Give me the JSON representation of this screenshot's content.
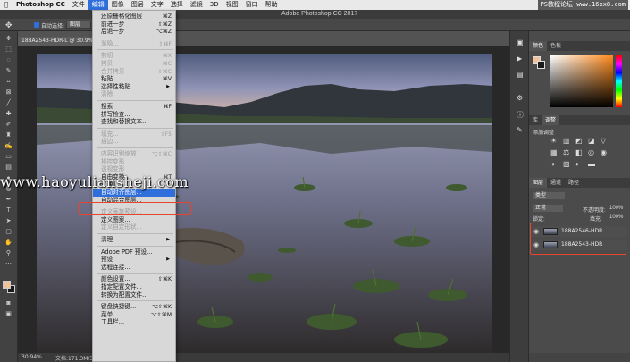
{
  "menubar": {
    "app_name": "Photoshop CC",
    "items": [
      "文件",
      "编辑",
      "图像",
      "图层",
      "文字",
      "选择",
      "滤镜",
      "3D",
      "视图",
      "窗口",
      "帮助"
    ],
    "active_item": "编辑"
  },
  "watermark_top": "PS教程论坛 www.16xx8.com",
  "window_title": "Adobe Photoshop CC 2017",
  "options_bar": {
    "auto_select_label": "自动选择:",
    "auto_select_value": "图层"
  },
  "document_tab": "188A2543-HDR-L @ 30.9% (RGB/8)",
  "status_bar": {
    "zoom": "30.94%",
    "doc_info": "文档:171.3M/343.4M"
  },
  "edit_menu": [
    {
      "label": "还原栅格化图层",
      "shortcut": "⌘Z",
      "enabled": true
    },
    {
      "label": "前进一步",
      "shortcut": "⇧⌘Z",
      "enabled": true
    },
    {
      "label": "后退一步",
      "shortcut": "⌥⌘Z",
      "enabled": true
    },
    {
      "sep": true
    },
    {
      "label": "渐隐...",
      "shortcut": "⇧⌘F",
      "enabled": false
    },
    {
      "sep": true
    },
    {
      "label": "剪切",
      "shortcut": "⌘X",
      "enabled": false
    },
    {
      "label": "拷贝",
      "shortcut": "⌘C",
      "enabled": false
    },
    {
      "label": "合并拷贝",
      "shortcut": "⇧⌘C",
      "enabled": false
    },
    {
      "label": "粘贴",
      "shortcut": "⌘V",
      "enabled": true
    },
    {
      "label": "选择性粘贴",
      "submenu": true,
      "enabled": true
    },
    {
      "label": "清除",
      "enabled": false
    },
    {
      "sep": true
    },
    {
      "label": "搜索",
      "shortcut": "⌘F",
      "enabled": true
    },
    {
      "label": "拼写检查...",
      "enabled": true
    },
    {
      "label": "查找和替换文本...",
      "enabled": true
    },
    {
      "sep": true
    },
    {
      "label": "填充...",
      "shortcut": "⇧F5",
      "enabled": false
    },
    {
      "label": "描边...",
      "enabled": false
    },
    {
      "sep": true
    },
    {
      "label": "内容识别缩放",
      "shortcut": "⌥⇧⌘C",
      "enabled": false
    },
    {
      "label": "操控变形",
      "enabled": false
    },
    {
      "label": "透视变形",
      "enabled": false
    },
    {
      "label": "自由变换",
      "shortcut": "⌘T",
      "enabled": true
    },
    {
      "label": "变换",
      "submenu": true,
      "enabled": true
    },
    {
      "label": "自动对齐图层...",
      "enabled": true,
      "highlighted": true
    },
    {
      "label": "自动混合图层...",
      "enabled": true
    },
    {
      "sep": true
    },
    {
      "label": "定义画笔预设...",
      "enabled": false
    },
    {
      "label": "定义图案...",
      "enabled": true
    },
    {
      "label": "定义自定形状...",
      "enabled": false
    },
    {
      "sep": true
    },
    {
      "label": "清理",
      "submenu": true,
      "enabled": true
    },
    {
      "sep": true
    },
    {
      "label": "Adobe PDF 预设...",
      "enabled": true
    },
    {
      "label": "预设",
      "submenu": true,
      "enabled": true
    },
    {
      "label": "远程连接...",
      "enabled": true
    },
    {
      "sep": true
    },
    {
      "label": "颜色设置...",
      "shortcut": "⇧⌘K",
      "enabled": true
    },
    {
      "label": "指定配置文件...",
      "enabled": true
    },
    {
      "label": "转换为配置文件...",
      "enabled": true
    },
    {
      "sep": true
    },
    {
      "label": "键盘快捷键...",
      "shortcut": "⌥⇧⌘K",
      "enabled": true
    },
    {
      "label": "菜单...",
      "shortcut": "⌥⇧⌘M",
      "enabled": true
    },
    {
      "label": "工具栏...",
      "enabled": true
    }
  ],
  "watermark_site": "www.haoyuliansheji.com",
  "right_panel": {
    "color_tabs": [
      "颜色",
      "色板"
    ],
    "adjust_tabs": [
      "库",
      "调整"
    ],
    "adjust_label": "添加调整",
    "layer_tabs": [
      "图层",
      "通道",
      "路径"
    ],
    "kind_label": "类型",
    "blend_mode": "正常",
    "opacity_label": "不透明度:",
    "opacity_value": "100%",
    "lock_label": "锁定:",
    "fill_label": "填充:",
    "fill_value": "100%",
    "layers": [
      "188A2546-HDR",
      "188A2543-HDR"
    ]
  },
  "colors": {
    "accent": "#2f6fdc",
    "callout": "#e8452f",
    "foreground_swatch": "#f2c29b",
    "background_swatch": "#1a1a1a"
  }
}
